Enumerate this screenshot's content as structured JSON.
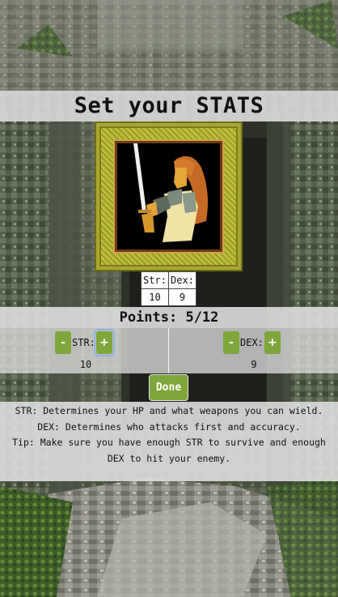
{
  "screen": {
    "title": "Set your STATS"
  },
  "portrait": {
    "icon": "warrior-woman-with-sword"
  },
  "stat_table": {
    "headers": [
      "Str:",
      "Dex:"
    ],
    "values": [
      "10",
      "9"
    ]
  },
  "points": {
    "text": "Points: 5/12",
    "used": 5,
    "total": 12
  },
  "controls": {
    "str": {
      "minus": "-",
      "label": "STR:",
      "plus": "+",
      "value": "10"
    },
    "dex": {
      "minus": "-",
      "label": "DEX:",
      "plus": "+",
      "value": "9"
    }
  },
  "done_label": "Done",
  "info": {
    "str": "STR: Determines your HP and what weapons you can wield.",
    "dex": "DEX: Determines who attacks first and accuracy.",
    "tip": "Tip: Make sure you have enough STR to survive and enough DEX to hit your enemy."
  },
  "colors": {
    "button": "#7ea63a",
    "panel": "#e1e1e1",
    "frame_gold": "#b8b83a"
  }
}
